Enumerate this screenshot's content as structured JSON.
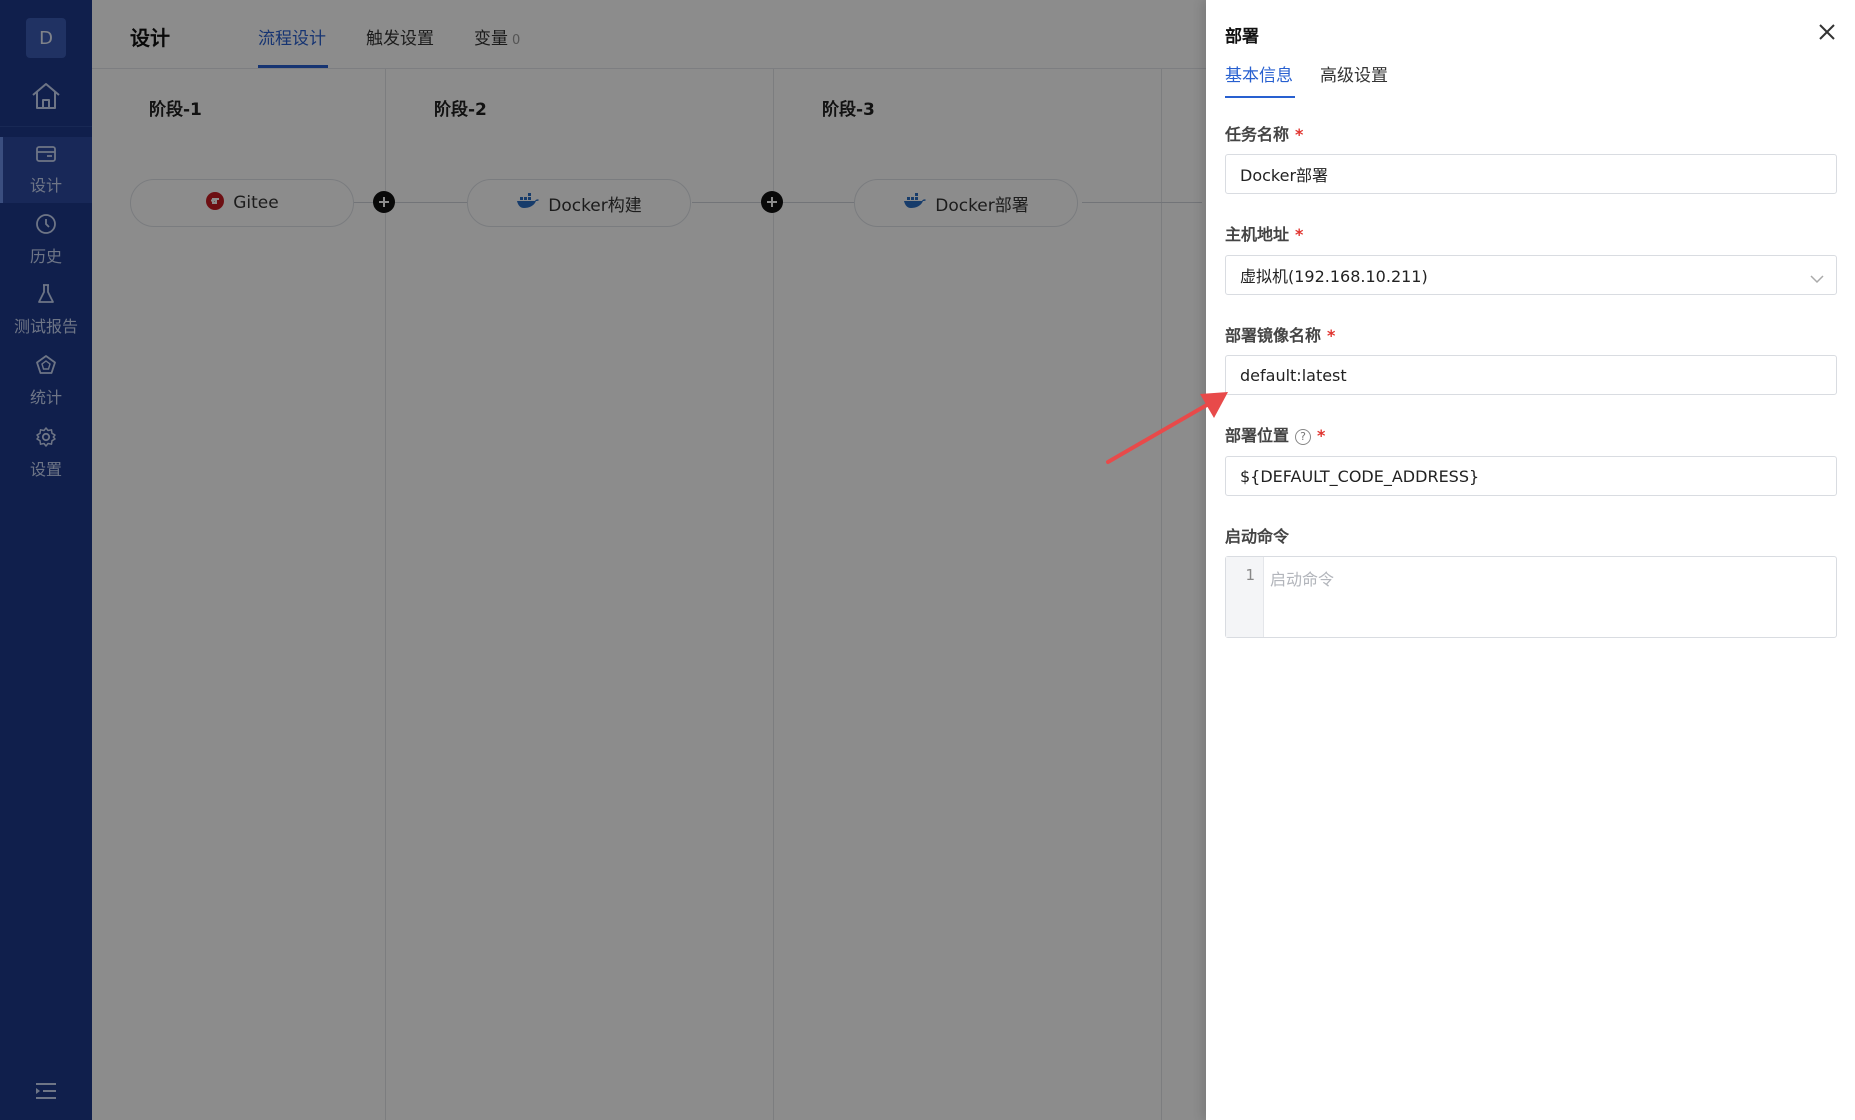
{
  "sidebar": {
    "avatar": "D",
    "items": [
      {
        "label": "设计",
        "icon": "pipeline-card-icon"
      },
      {
        "label": "历史",
        "icon": "clock-icon"
      },
      {
        "label": "测试报告",
        "icon": "flask-icon"
      },
      {
        "label": "统计",
        "icon": "pentagon-chart-icon"
      },
      {
        "label": "设置",
        "icon": "gear-icon"
      }
    ]
  },
  "header": {
    "title": "设计",
    "tabs": [
      {
        "label": "流程设计"
      },
      {
        "label": "触发设置"
      },
      {
        "label": "变量",
        "badge": "0"
      }
    ]
  },
  "stages": [
    {
      "title": "阶段-1",
      "task": "Gitee",
      "icon": "gitee-icon"
    },
    {
      "title": "阶段-2",
      "task": "Docker构建",
      "icon": "docker-icon"
    },
    {
      "title": "阶段-3",
      "task": "Docker部署",
      "icon": "docker-icon"
    }
  ],
  "drawer": {
    "title": "部署",
    "tabs": [
      {
        "label": "基本信息"
      },
      {
        "label": "高级设置"
      }
    ],
    "fields": {
      "task_name": {
        "label": "任务名称",
        "value": "Docker部署"
      },
      "host": {
        "label": "主机地址",
        "value": "虚拟机(192.168.10.211)"
      },
      "image": {
        "label": "部署镜像名称",
        "value": "default:latest"
      },
      "location": {
        "label": "部署位置",
        "value": "${DEFAULT_CODE_ADDRESS}"
      },
      "command": {
        "label": "启动命令",
        "placeholder": "启动命令",
        "line": "1"
      }
    },
    "required_mark": "*",
    "help_mark": "?"
  },
  "colors": {
    "sidebar_bg": "#1e3a8a",
    "accent": "#2860d0",
    "required": "#e0342f",
    "arrow": "#e84a4a"
  }
}
